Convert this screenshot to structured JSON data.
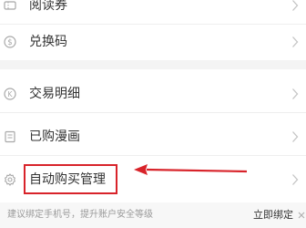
{
  "menu": {
    "items": [
      {
        "label": "阅读券",
        "icon": "ticket-icon"
      },
      {
        "label": "兑换码",
        "icon": "dollar-coin-icon"
      },
      {
        "label": "交易明细",
        "icon": "k-coin-icon"
      },
      {
        "label": "已购漫画",
        "icon": "book-icon"
      },
      {
        "label": "自动购买管理",
        "icon": "gear-icon"
      }
    ]
  },
  "annotation": {
    "highlight_color": "#d8232a",
    "arrow_color": "#d8232a"
  },
  "banner": {
    "text": "建议绑定手机号，提升账户安全等级",
    "action_label": "立即绑定",
    "close_icon": "close-icon"
  },
  "colors": {
    "text": "#333333",
    "icon": "#a8a8a8",
    "divider": "#eeeeee",
    "group_gap": "#f4f4f4"
  }
}
